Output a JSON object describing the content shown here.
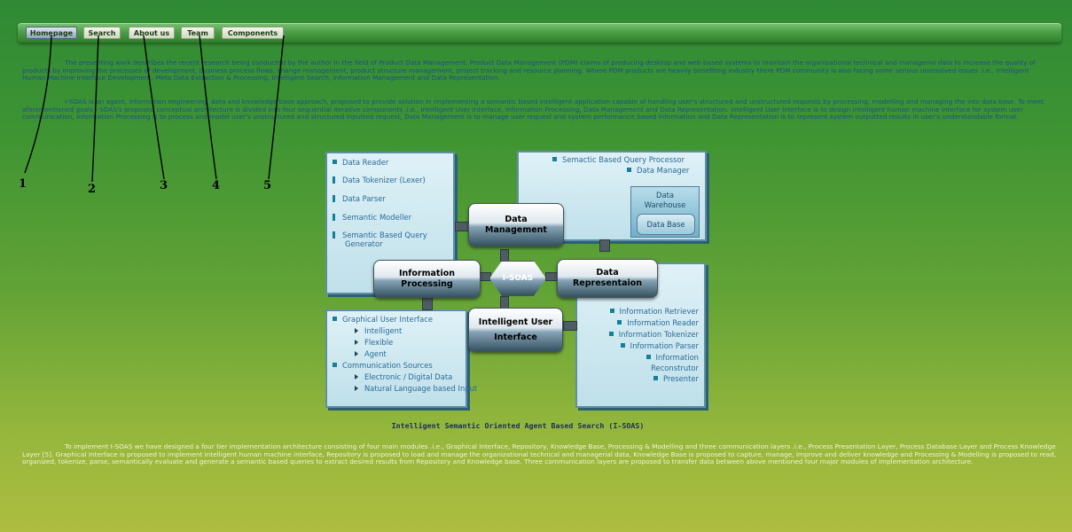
{
  "nav": {
    "items": [
      {
        "label": "Homepage"
      },
      {
        "label": "Search"
      },
      {
        "label": "About us"
      },
      {
        "label": "Team"
      },
      {
        "label": "Components"
      }
    ]
  },
  "intro": {
    "p1": "The presenting work describes the recent research being conducted by the author in the field of Product Data Management. Product Data Management (PDM) claims of producing desktop and web based systems to maintain the organizational technical and managerial data to increase the quality of products by improving the processes of development, business process flows, change management, product structure management, project tracking and resource planning.  Where PDM products are heavily benefiting industry there PDM community is also facing some serious unresolved issues .i.e., Intelligent Human Machine Interface Development, Meta Data Extraction & Processing, Intelligent Search, Information Management and Data Representation.",
    "p2": "I-SOAS is an agent, information engineering, data and knowledge base approach, proposed to provide solution in implementing a semantic based intelligent application capable of handling user's structured and unstructured requests by processing, modelling and managing the into data base.  To meet aforementioned goals I-SOAS's proposed conceptual architecture is divided into four sequential iterative components .i.e., Intelligent User Interface, Information Processing, Data Management and Data Representation. Intelligent User Interface is to design intelligent human machine interface for system user communication, Information Processing is to process and model user's unstructured and structured inputted request, Data Management is to manage user request and system performance based information and Data Representation is to represent system outputted results in user's understandable format."
  },
  "callouts": [
    "1",
    "2",
    "3",
    "4",
    "5"
  ],
  "diagram": {
    "top_left_items": [
      "Data Reader",
      "Data Tokenizer (Lexer)",
      "Data Parser",
      "Semantic Modeller",
      "Semantic Based Query",
      "Generator"
    ],
    "top_right_items": [
      "Semactic Based Query Processor",
      "Data Manager"
    ],
    "warehouse_label": "Data Warehouse",
    "database_label": "Data Base",
    "bottom_left": {
      "gui": "Graphical User Interface",
      "gui_sub": [
        "Intelligent",
        "Flexible",
        "Agent"
      ],
      "comm": "Communication Sources",
      "comm_sub": [
        "Electronic / Digital Data",
        "Natural Language based Input"
      ]
    },
    "bottom_right_items": [
      "Information Retriever",
      "Information Reader",
      "Information Tokenizer",
      "Information Parser",
      "Information",
      "Reconstrutor",
      "Presenter"
    ],
    "modules": {
      "data_management": "Data Management",
      "information_processing": "Information Processing",
      "core": "I-SOAS",
      "data_representation": "Data Representaion",
      "intelligent_user_interface": "Intelligent User Interface"
    },
    "caption": "Intelligent Semantic Oriented Agent Based Search (I-SOAS)"
  },
  "bottom_para": "To implement I-SOAS we have designed a four tier implementation architecture consisting of four main modules .i.e., Graphical Interface, Repository, Knowledge Base, Processing & Modelling and three communication layers .i.e., Process Presentation Layer, Process Database Layer and Process Knowledge Layer [5]. Graphical Interface is proposed to implement intelligent human machine interface, Repository is proposed to load and manage the organizational technical and managerial data, Knowledge Base is proposed to capture, manage, improve and deliver knowledge and Processing & Modelling is proposed to read, organized, tokenize, parse, semantically evaluate and generate a semantic based queries to extract desired results from Repository and Knowledge base. Three communication layers are proposed to transfer data between above mentioned four major modules of implementation architecture."
}
